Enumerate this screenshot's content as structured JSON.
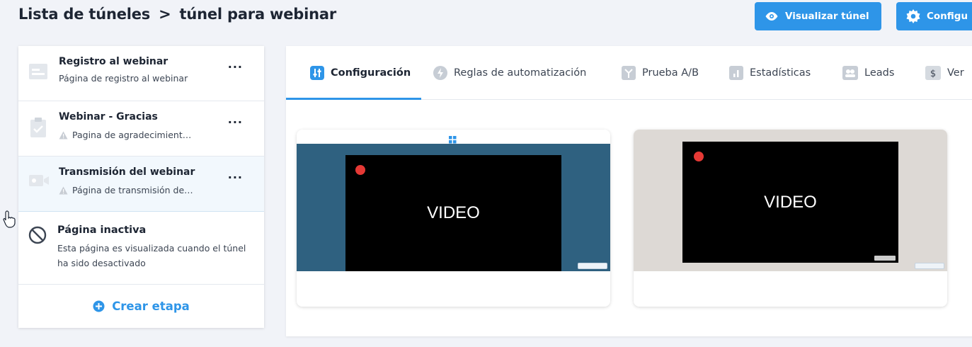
{
  "header": {
    "breadcrumb_root": "Lista de túneles",
    "breadcrumb_separator": ">",
    "breadcrumb_current": "túnel para webinar",
    "visualize_label": "Visualizar túnel",
    "config_label": "Configu"
  },
  "sidebar": {
    "stages": [
      {
        "title": "Registro al webinar",
        "subtitle": "Página de registro al webinar",
        "menu": "..."
      },
      {
        "title": "Webinar - Gracias",
        "subtitle": "Pagina de agradecimient…",
        "menu": "..."
      },
      {
        "title": "Transmisión del webinar",
        "subtitle": "Página de transmisión de…",
        "menu": "..."
      }
    ],
    "inactive": {
      "title": "Página inactiva",
      "description": "Esta página es visualizada cuando el túnel ha sido desactivado"
    },
    "create_label": "Crear etapa"
  },
  "tabs": [
    {
      "label": "Configuración",
      "icon": "sliders-icon"
    },
    {
      "label": "Reglas de automatización",
      "icon": "bolt-icon"
    },
    {
      "label": "Prueba A/B",
      "icon": "split-icon"
    },
    {
      "label": "Estadísticas",
      "icon": "bar-chart-icon"
    },
    {
      "label": "Leads",
      "icon": "users-icon"
    },
    {
      "label": "Ver",
      "icon": "dollar-icon",
      "glyph": "$"
    }
  ],
  "previews": {
    "video_label_1": "VIDEO",
    "video_label_2": "VIDEO"
  },
  "colors": {
    "accent": "#2e95e8",
    "text": "#1d2533",
    "preview_blue": "#2f6180",
    "mute_red": "#e53935"
  }
}
